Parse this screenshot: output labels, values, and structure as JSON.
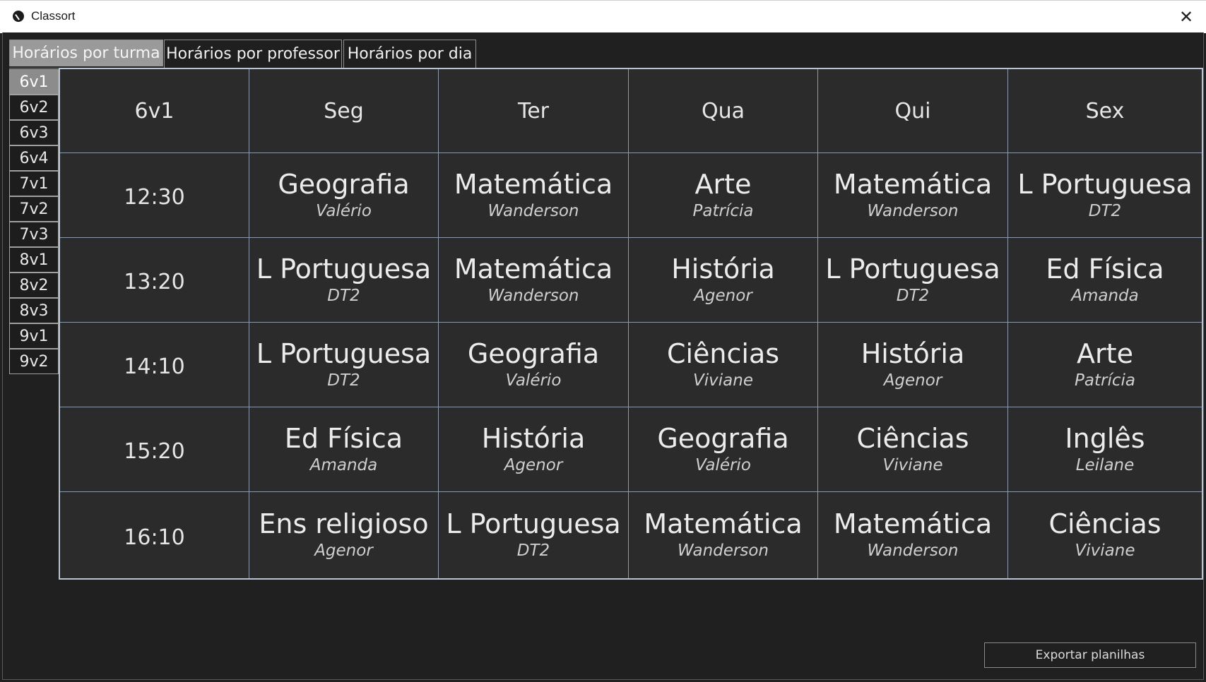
{
  "window": {
    "title": "Classort",
    "close_symbol": "✕",
    "app_icon": "classort-logo-icon"
  },
  "tabs": [
    {
      "label": "Horários por turma",
      "active": true
    },
    {
      "label": "Horários por professor",
      "active": false
    },
    {
      "label": "Horários por dia",
      "active": false
    }
  ],
  "classes": [
    "6v1",
    "6v2",
    "6v3",
    "6v4",
    "7v1",
    "7v2",
    "7v3",
    "8v1",
    "8v2",
    "8v3",
    "9v1",
    "9v2"
  ],
  "selected_class": "6v1",
  "schedule": {
    "corner": "6v1",
    "days": [
      "Seg",
      "Ter",
      "Qua",
      "Qui",
      "Sex"
    ],
    "rows": [
      {
        "time": "12:30",
        "slots": [
          {
            "subject": "Geografia",
            "teacher": "Valério"
          },
          {
            "subject": "Matemática",
            "teacher": "Wanderson"
          },
          {
            "subject": "Arte",
            "teacher": "Patrícia"
          },
          {
            "subject": "Matemática",
            "teacher": "Wanderson"
          },
          {
            "subject": "L Portuguesa",
            "teacher": "DT2"
          }
        ]
      },
      {
        "time": "13:20",
        "slots": [
          {
            "subject": "L Portuguesa",
            "teacher": "DT2"
          },
          {
            "subject": "Matemática",
            "teacher": "Wanderson"
          },
          {
            "subject": "História",
            "teacher": "Agenor"
          },
          {
            "subject": "L Portuguesa",
            "teacher": "DT2"
          },
          {
            "subject": "Ed Física",
            "teacher": "Amanda"
          }
        ]
      },
      {
        "time": "14:10",
        "slots": [
          {
            "subject": "L Portuguesa",
            "teacher": "DT2"
          },
          {
            "subject": "Geografia",
            "teacher": "Valério"
          },
          {
            "subject": "Ciências",
            "teacher": "Viviane"
          },
          {
            "subject": "História",
            "teacher": "Agenor"
          },
          {
            "subject": "Arte",
            "teacher": "Patrícia"
          }
        ]
      },
      {
        "time": "15:20",
        "slots": [
          {
            "subject": "Ed Física",
            "teacher": "Amanda"
          },
          {
            "subject": "História",
            "teacher": "Agenor"
          },
          {
            "subject": "Geografia",
            "teacher": "Valério"
          },
          {
            "subject": "Ciências",
            "teacher": "Viviane"
          },
          {
            "subject": "Inglês",
            "teacher": "Leilane"
          }
        ]
      },
      {
        "time": "16:10",
        "slots": [
          {
            "subject": "Ens religioso",
            "teacher": "Agenor"
          },
          {
            "subject": "L Portuguesa",
            "teacher": "DT2"
          },
          {
            "subject": "Matemática",
            "teacher": "Wanderson"
          },
          {
            "subject": "Matemática",
            "teacher": "Wanderson"
          },
          {
            "subject": "Ciências",
            "teacher": "Viviane"
          }
        ]
      }
    ]
  },
  "export_button": "Exportar planilhas"
}
